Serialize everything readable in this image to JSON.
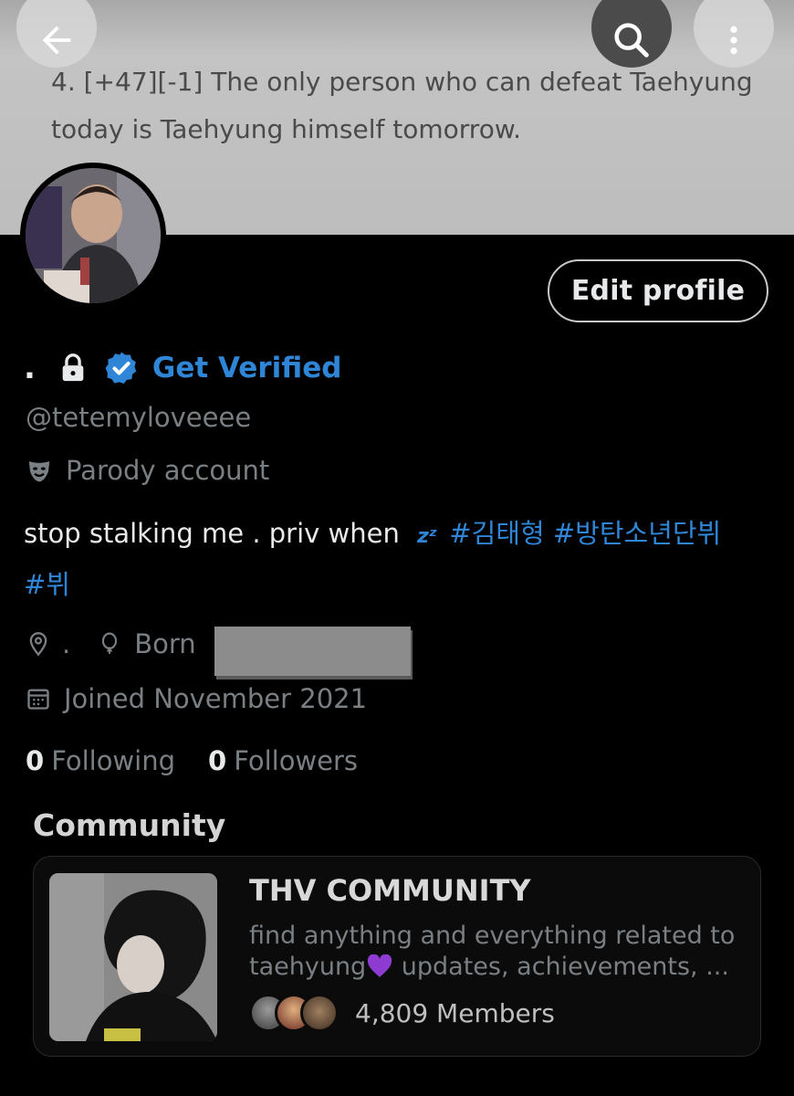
{
  "banner": {
    "text_line1": "4. [+47][-1] The only person who can defeat Taehyung",
    "text_line2": "today is Taehyung himself tomorrow."
  },
  "icons": {
    "back": "arrow-left-icon",
    "search": "search-icon",
    "more": "more-vertical-icon",
    "lock": "lock-icon",
    "verified": "verified-badge-icon",
    "parody": "theater-mask-icon",
    "location": "location-pin-icon",
    "birthday": "balloon-icon",
    "calendar": "calendar-icon",
    "zzz": "zzz-emoji",
    "heart": "purple-heart-emoji"
  },
  "profile": {
    "edit_button": "Edit profile",
    "display_name": ".",
    "get_verified": "Get Verified",
    "handle": "@tetemyloveeee",
    "parody_label": "Parody account",
    "bio_text": "stop stalking me . priv when",
    "bio_tags": [
      "#김태형",
      "#방탄소년단뷔",
      "#뷔"
    ],
    "location": ".",
    "born_label": "Born",
    "joined": "Joined November 2021",
    "following_count": "0",
    "following_label": "Following",
    "followers_count": "0",
    "followers_label": "Followers"
  },
  "community": {
    "heading": "Community",
    "name": "THV COMMUNITY",
    "description_line1": "find anything and everything related to",
    "description_line2_pre": "taehyung",
    "description_line2_post": " updates, achievements, ...",
    "members": "4,809 Members"
  },
  "colors": {
    "accent": "#2f86d6",
    "background": "#000000",
    "muted_text": "#7a7f83",
    "heart": "#8e3bd1"
  }
}
